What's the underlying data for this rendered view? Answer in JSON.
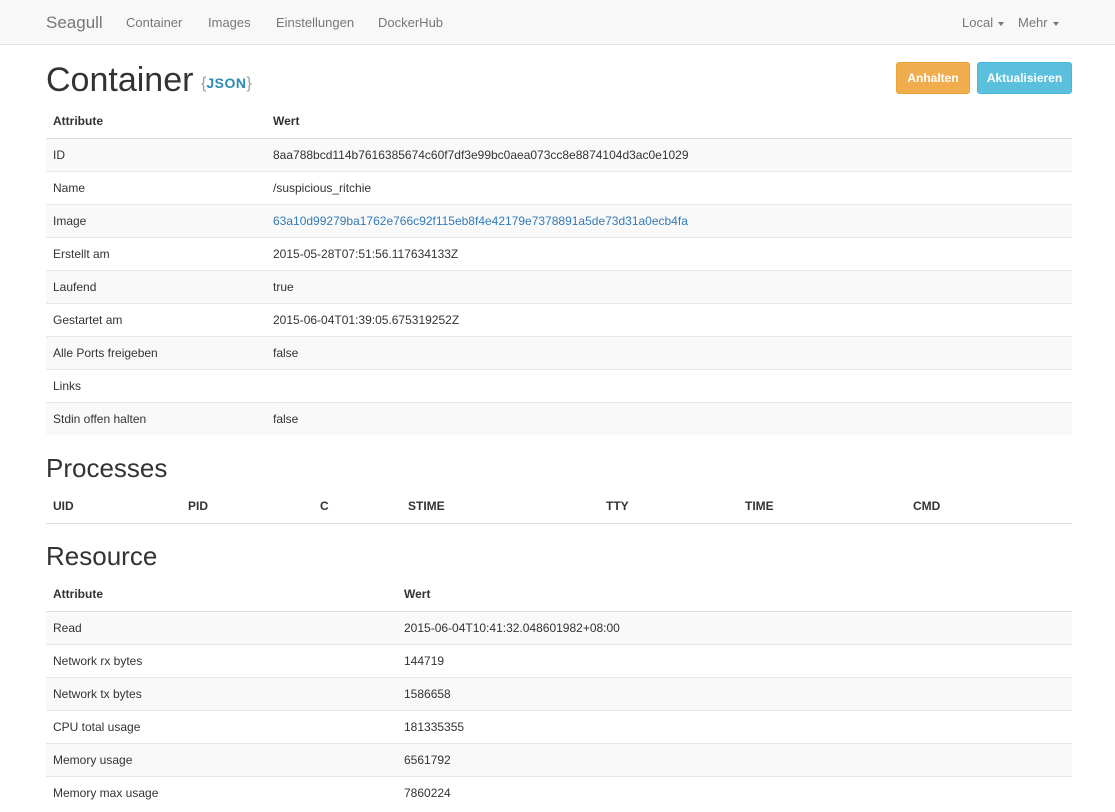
{
  "navbar": {
    "brand": "Seagull",
    "links": [
      "Container",
      "Images",
      "Einstellungen",
      "DockerHub"
    ],
    "right": [
      "Local",
      "Mehr"
    ]
  },
  "header": {
    "title": "Container",
    "json_open": "{",
    "json_label": "JSON",
    "json_close": "}",
    "stop_button": "Anhalten",
    "refresh_button": "Aktualisieren"
  },
  "container_table": {
    "headers": [
      "Attribute",
      "Wert"
    ],
    "rows": [
      {
        "attr": "ID",
        "value": "8aa788bcd114b7616385674c60f7df3e99bc0aea073cc8e8874104d3ac0e1029"
      },
      {
        "attr": "Name",
        "value": "/suspicious_ritchie"
      },
      {
        "attr": "Image",
        "value": "63a10d99279ba1762e766c92f115eb8f4e42179e7378891a5de73d31a0ecb4fa"
      },
      {
        "attr": "Erstellt am",
        "value": "2015-05-28T07:51:56.117634133Z"
      },
      {
        "attr": "Laufend",
        "value": "true"
      },
      {
        "attr": "Gestartet am",
        "value": "2015-06-04T01:39:05.675319252Z"
      },
      {
        "attr": "Alle Ports freigeben",
        "value": "false"
      },
      {
        "attr": "Links",
        "value": ""
      },
      {
        "attr": "Stdin offen halten",
        "value": "false"
      }
    ]
  },
  "processes": {
    "title": "Processes",
    "headers": [
      "UID",
      "PID",
      "C",
      "STIME",
      "TTY",
      "TIME",
      "CMD"
    ]
  },
  "resource": {
    "title": "Resource",
    "headers": [
      "Attribute",
      "Wert"
    ],
    "rows": [
      {
        "attr": "Read",
        "value": "2015-06-04T10:41:32.048601982+08:00"
      },
      {
        "attr": "Network rx bytes",
        "value": "144719"
      },
      {
        "attr": "Network tx bytes",
        "value": "1586658"
      },
      {
        "attr": "CPU total usage",
        "value": "181335355"
      },
      {
        "attr": "Memory usage",
        "value": "6561792"
      },
      {
        "attr": "Memory max usage",
        "value": "7860224"
      }
    ]
  },
  "colors": {
    "navbar_bg": "#f8f8f8",
    "link": "#337ab7",
    "warning": "#f0ad4e",
    "info": "#5bc0de"
  }
}
